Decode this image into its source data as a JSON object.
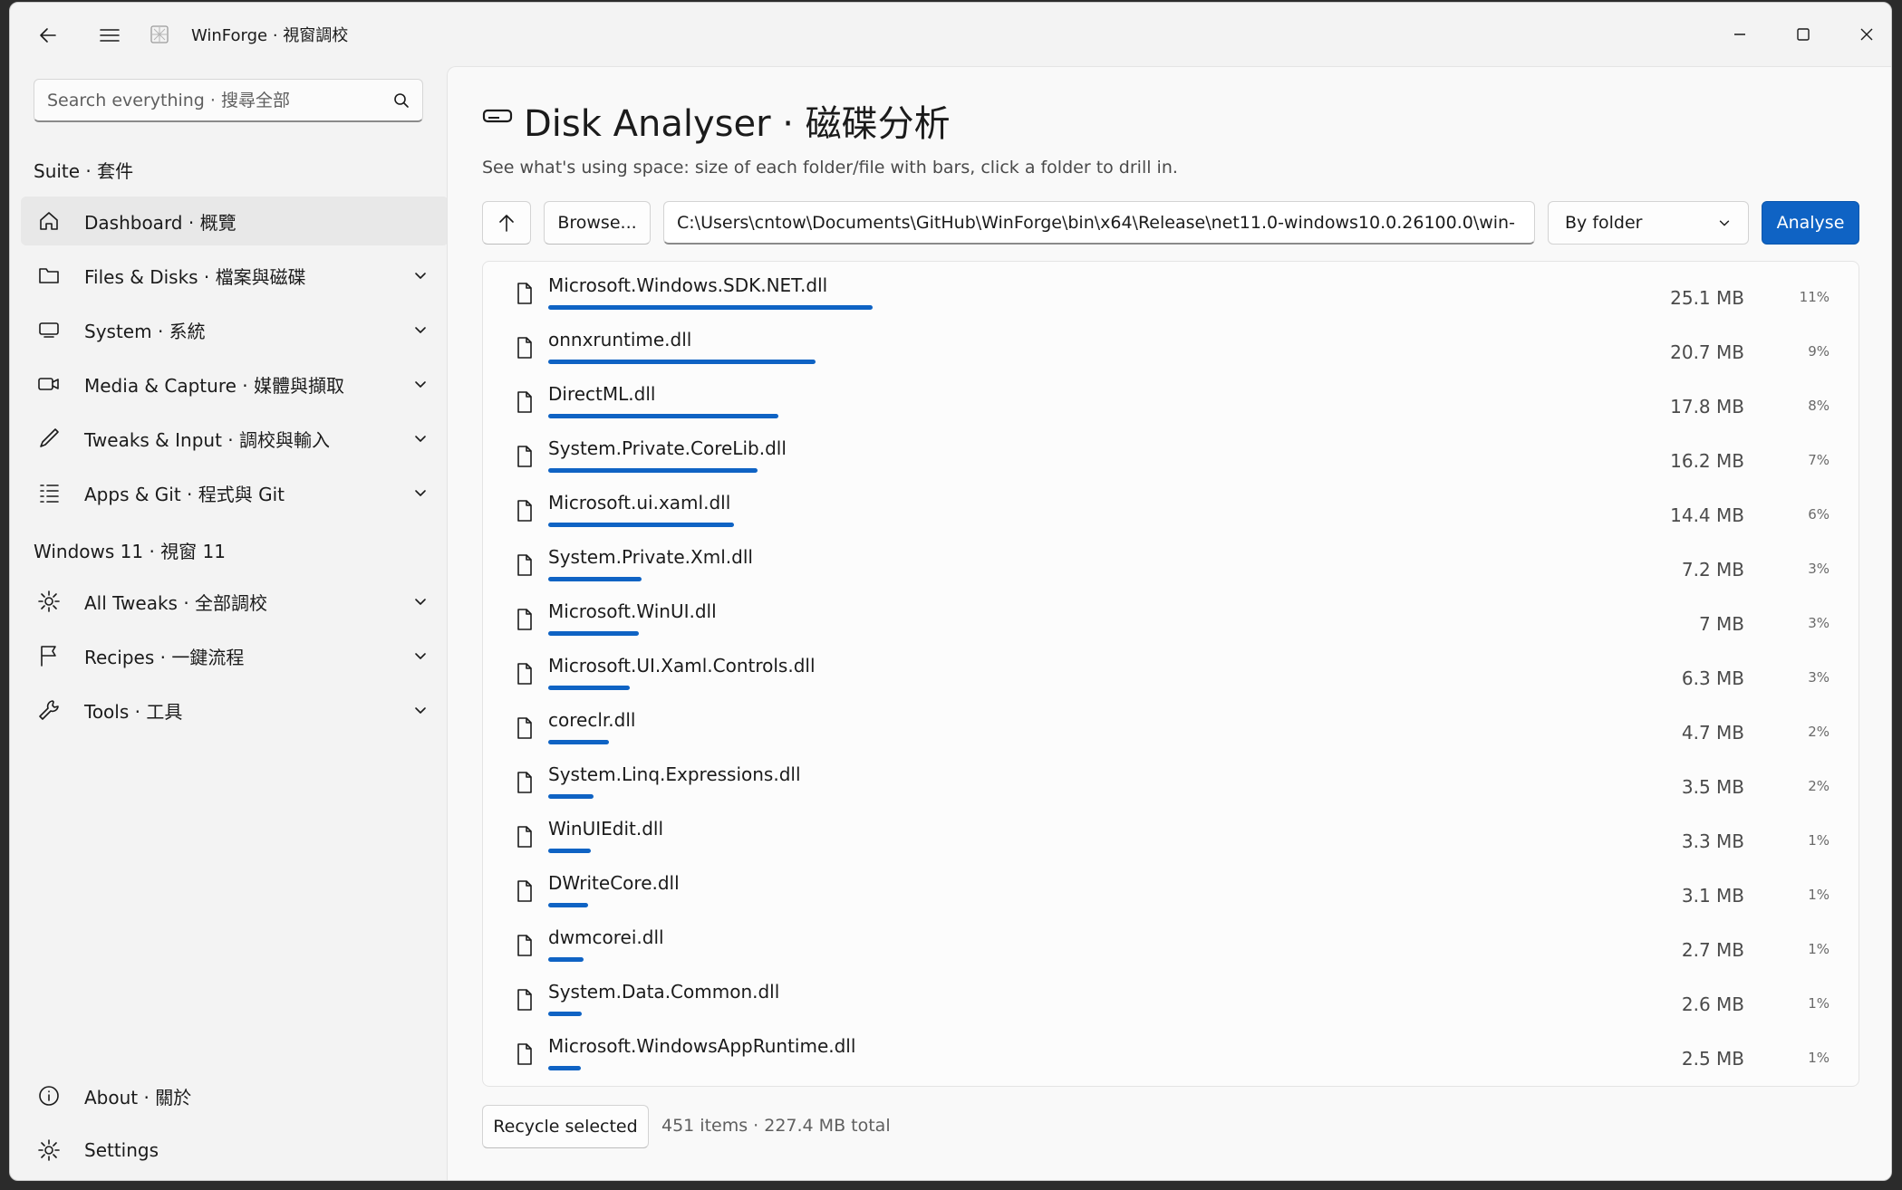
{
  "window": {
    "title": "WinForge · 視窗調校"
  },
  "sidebar": {
    "search_placeholder": "Search everything · 搜尋全部",
    "section_suite": "Suite · 套件",
    "section_windows": "Windows 11 · 視窗 11",
    "items": [
      {
        "label": "Dashboard · 概覽",
        "icon": "home-icon",
        "expandable": false,
        "selected": true
      },
      {
        "label": "Files & Disks · 檔案與磁碟",
        "icon": "folder-icon",
        "expandable": true
      },
      {
        "label": "System · 系統",
        "icon": "monitor-icon",
        "expandable": true
      },
      {
        "label": "Media & Capture · 媒體與擷取",
        "icon": "camera-icon",
        "expandable": true
      },
      {
        "label": "Tweaks & Input · 調校與輸入",
        "icon": "pen-icon",
        "expandable": true
      },
      {
        "label": "Apps & Git · 程式與 Git",
        "icon": "list-icon",
        "expandable": true
      },
      {
        "label": "All Tweaks · 全部調校",
        "icon": "gear-icon",
        "expandable": true
      },
      {
        "label": "Recipes · 一鍵流程",
        "icon": "flag-icon",
        "expandable": true
      },
      {
        "label": "Tools · 工具",
        "icon": "wrench-icon",
        "expandable": true
      }
    ],
    "footer_items": [
      {
        "label": "About · 關於",
        "icon": "info-icon"
      },
      {
        "label": "Settings",
        "icon": "gear-icon"
      }
    ]
  },
  "main": {
    "title": "Disk Analyser · 磁碟分析",
    "description": "See what's using space: size of each folder/file with bars, click a folder to drill in.",
    "browse_label": "Browse...",
    "path_value": "C:\\Users\\cntow\\Documents\\GitHub\\WinForge\\bin\\x64\\Release\\net11.0-windows10.0.26100.0\\win-",
    "group_mode": "By folder",
    "analyse_label": "Analyse",
    "recycle_label": "Recycle selected",
    "status": "451 items · 227.4 MB total",
    "accent_color": "#0f63c4",
    "files": [
      {
        "name": "Microsoft.Windows.SDK.NET.dll",
        "size": "25.1 MB",
        "pct": "11%",
        "fraction": 1.0
      },
      {
        "name": "onnxruntime.dll",
        "size": "20.7 MB",
        "pct": "9%",
        "fraction": 0.825
      },
      {
        "name": "DirectML.dll",
        "size": "17.8 MB",
        "pct": "8%",
        "fraction": 0.709
      },
      {
        "name": "System.Private.CoreLib.dll",
        "size": "16.2 MB",
        "pct": "7%",
        "fraction": 0.645
      },
      {
        "name": "Microsoft.ui.xaml.dll",
        "size": "14.4 MB",
        "pct": "6%",
        "fraction": 0.574
      },
      {
        "name": "System.Private.Xml.dll",
        "size": "7.2 MB",
        "pct": "3%",
        "fraction": 0.287
      },
      {
        "name": "Microsoft.WinUI.dll",
        "size": "7 MB",
        "pct": "3%",
        "fraction": 0.279
      },
      {
        "name": "Microsoft.UI.Xaml.Controls.dll",
        "size": "6.3 MB",
        "pct": "3%",
        "fraction": 0.251
      },
      {
        "name": "coreclr.dll",
        "size": "4.7 MB",
        "pct": "2%",
        "fraction": 0.187
      },
      {
        "name": "System.Linq.Expressions.dll",
        "size": "3.5 MB",
        "pct": "2%",
        "fraction": 0.139
      },
      {
        "name": "WinUIEdit.dll",
        "size": "3.3 MB",
        "pct": "1%",
        "fraction": 0.131
      },
      {
        "name": "DWriteCore.dll",
        "size": "3.1 MB",
        "pct": "1%",
        "fraction": 0.124
      },
      {
        "name": "dwmcorei.dll",
        "size": "2.7 MB",
        "pct": "1%",
        "fraction": 0.108
      },
      {
        "name": "System.Data.Common.dll",
        "size": "2.6 MB",
        "pct": "1%",
        "fraction": 0.104
      },
      {
        "name": "Microsoft.WindowsAppRuntime.dll",
        "size": "2.5 MB",
        "pct": "1%",
        "fraction": 0.1
      }
    ]
  }
}
